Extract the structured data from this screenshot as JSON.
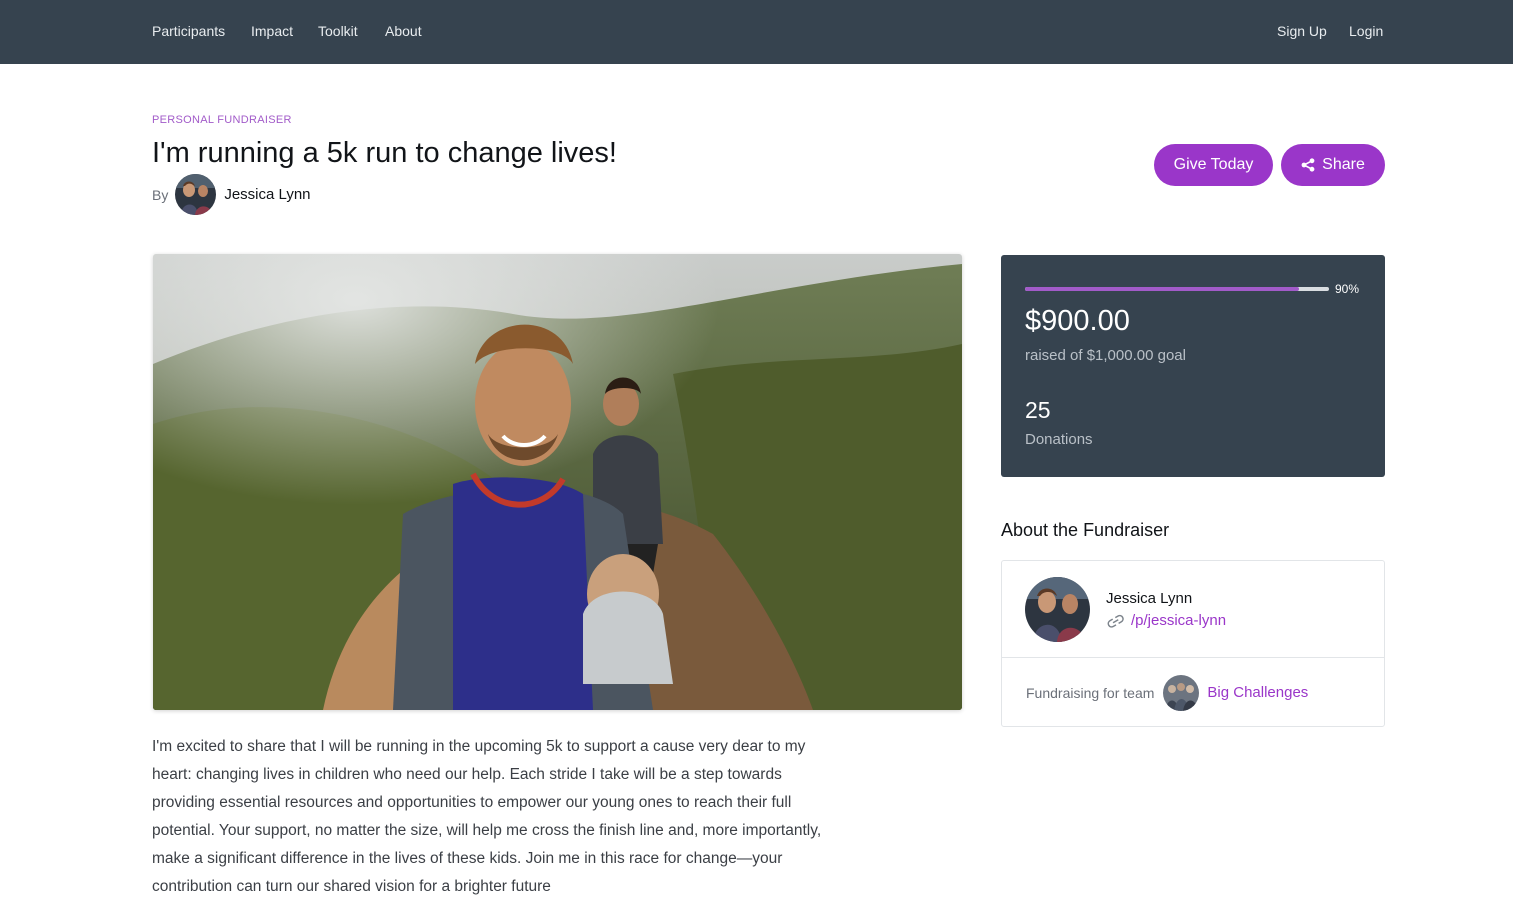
{
  "nav": {
    "left": [
      "Participants",
      "Impact",
      "Toolkit",
      "About"
    ],
    "signup": "Sign Up",
    "login": "Login"
  },
  "header": {
    "kicker": "PERSONAL FUNDRAISER",
    "title": "I'm running a 5k run to change lives!",
    "by_label": "By",
    "author": "Jessica Lynn"
  },
  "actions": {
    "give": "Give Today",
    "share": "Share",
    "share_icon": "share-icon"
  },
  "story": "I'm excited to share that I will be running in the upcoming 5k to support a cause very dear to my heart: changing lives in children who need our help. Each stride I take will be a step towards providing essential resources and opportunities to empower our young ones to reach their full potential. Your support, no matter the size, will help me cross the finish line and, more importantly, make a significant difference in the lives of these kids. Join me in this race for change—your contribution can turn our shared vision for a brighter future",
  "stats": {
    "progress_fraction": 0.9,
    "progress_label": "90%",
    "raised": "$900.00",
    "goal_text": "raised of $1,000.00 goal",
    "donations_count": "25",
    "donations_label": "Donations"
  },
  "about": {
    "heading": "About the Fundraiser",
    "name": "Jessica Lynn",
    "link": "/p/jessica-lynn",
    "link_icon": "link-icon",
    "team_label": "Fundraising for team",
    "team_name": "Big Challenges"
  },
  "colors": {
    "nav_bg": "#36434f",
    "accent": "#9a36c9",
    "kicker": "#a25bc9",
    "stats_bg": "#36434f"
  }
}
